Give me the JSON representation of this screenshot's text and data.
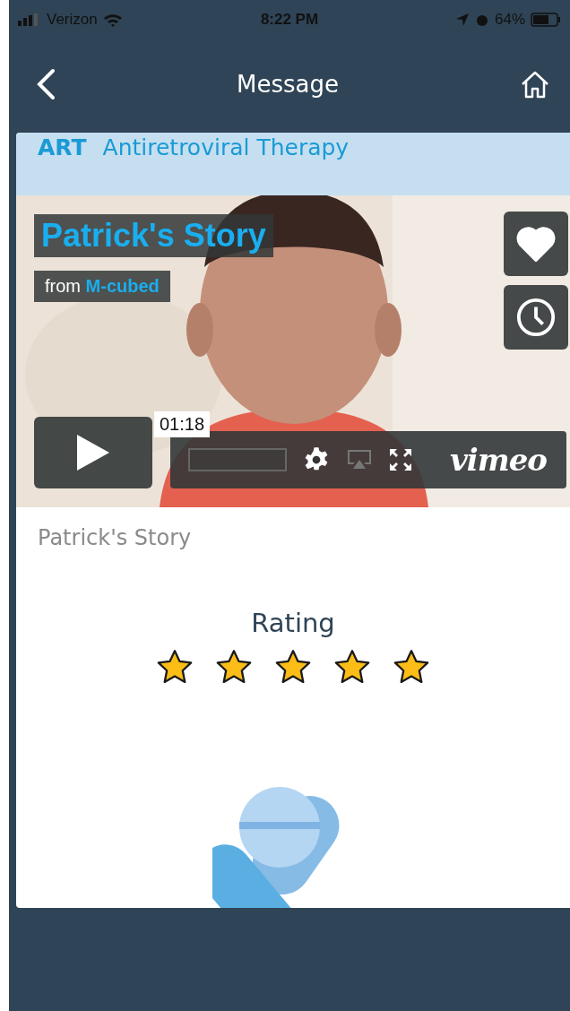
{
  "status_bar": {
    "carrier": "Verizon",
    "time": "8:22 PM",
    "battery": "64%"
  },
  "nav": {
    "title": "Message"
  },
  "card": {
    "tag": "ART",
    "topic": "Antiretroviral Therapy",
    "video": {
      "title": "Patrick's Story",
      "byline": "from",
      "author": "M-cubed",
      "liked": true,
      "timecode": "01:18",
      "brand": "vimeo"
    },
    "caption": "Patrick's Story",
    "rating": {
      "label": "Rating",
      "stars": 5
    }
  }
}
